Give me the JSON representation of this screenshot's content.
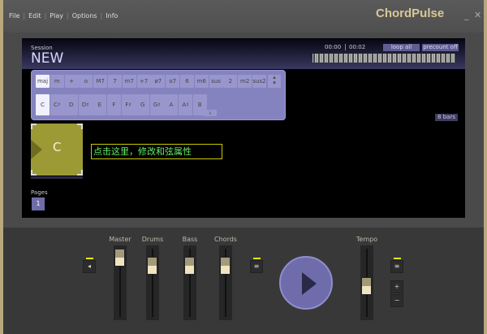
{
  "menu": [
    "File",
    "Edit",
    "Play",
    "Options",
    "Info"
  ],
  "app_title": "ChordPulse",
  "session": {
    "label": "Session",
    "name": "NEW"
  },
  "time": {
    "current": "00:00",
    "total": "00:02"
  },
  "buttons": {
    "loop": "loop all",
    "precount": "precount off",
    "bars": "8 bars",
    "flat": "♭"
  },
  "chord_types": [
    "maj",
    "m",
    "+",
    "o",
    "M7",
    "7",
    "m7",
    "+7",
    "ø7",
    "o7",
    "6",
    "m6",
    "sus",
    "2",
    "m2",
    "sus2"
  ],
  "roots": [
    "C",
    "C♯",
    "D",
    "D♯",
    "E",
    "F",
    "F♯",
    "G",
    "G♯",
    "A",
    "A♯",
    "B"
  ],
  "selected_type": "maj",
  "selected_root": "C",
  "chord_block": "C",
  "tooltip": "点击这里，修改和弦属性",
  "pages": {
    "label": "Pages",
    "items": [
      "1"
    ]
  },
  "mixer": {
    "labels": [
      "Master",
      "Drums",
      "Bass",
      "Chords",
      "Tempo"
    ],
    "levels": [
      0.95,
      0.8,
      0.8,
      0.8,
      0.45
    ]
  },
  "tempo": {
    "plus": "+",
    "minus": "−"
  },
  "colors": {
    "accent": "#8583bf",
    "chord": "#9c9a34",
    "tooltip": "#66ee66"
  }
}
